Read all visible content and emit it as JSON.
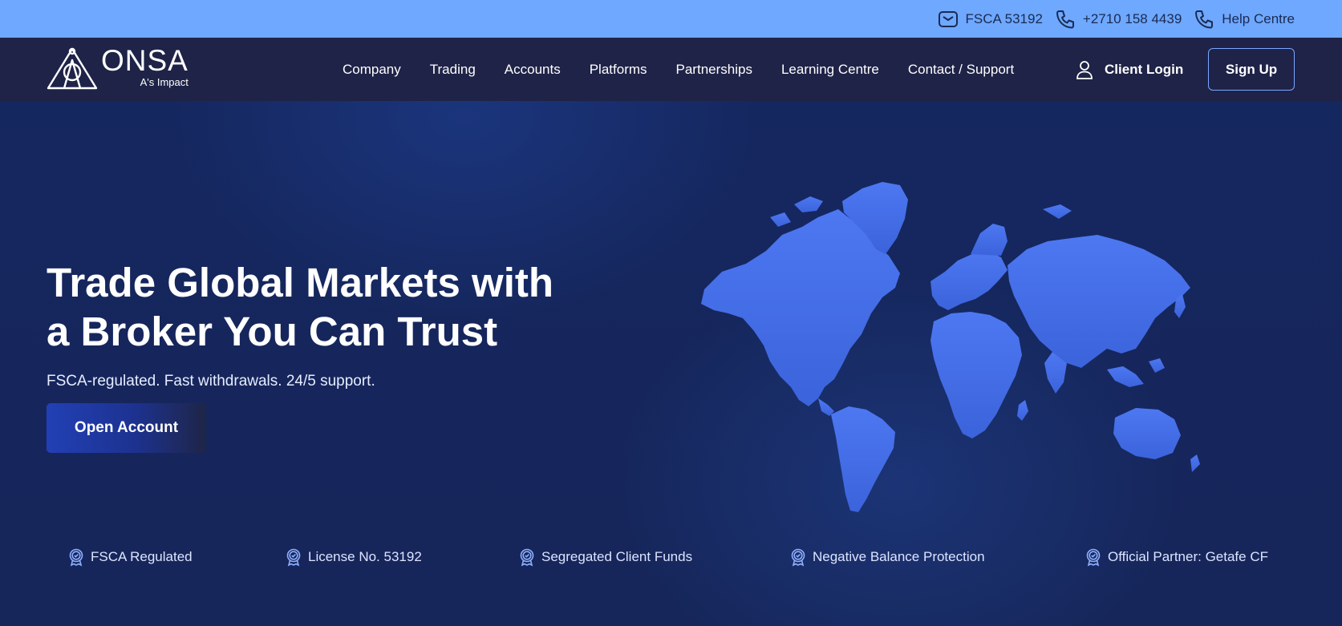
{
  "topbar": {
    "items": [
      {
        "icon": "mail-icon",
        "label": "FSCA 53192"
      },
      {
        "icon": "phone-icon",
        "label": "+2710 158 4439"
      },
      {
        "icon": "phone-icon",
        "label": "Help Centre"
      }
    ]
  },
  "brand": {
    "name": "ONSA",
    "tagline": "A's Impact"
  },
  "nav": {
    "items": [
      "Company",
      "Trading",
      "Accounts",
      "Platforms",
      "Partnerships",
      "Learning Centre",
      "Contact / Support"
    ],
    "client_login": "Client Login",
    "signup": "Sign Up"
  },
  "hero": {
    "headline_line1": "Trade Global Markets with",
    "headline_line2": "a Broker You Can Trust",
    "subline": "FSCA-regulated. Fast withdrawals. 24/5 support.",
    "cta": "Open Account"
  },
  "badges": [
    "FSCA Regulated",
    "License No. 53192",
    "Segregated Client Funds",
    "Negative Balance Protection",
    "Official Partner: Getafe CF"
  ],
  "colors": {
    "topbar": "#6ea8ff",
    "nav": "#1f2347",
    "hero": "#16275e",
    "map": "#4a74f0",
    "accent_border": "#7aa6ff"
  }
}
